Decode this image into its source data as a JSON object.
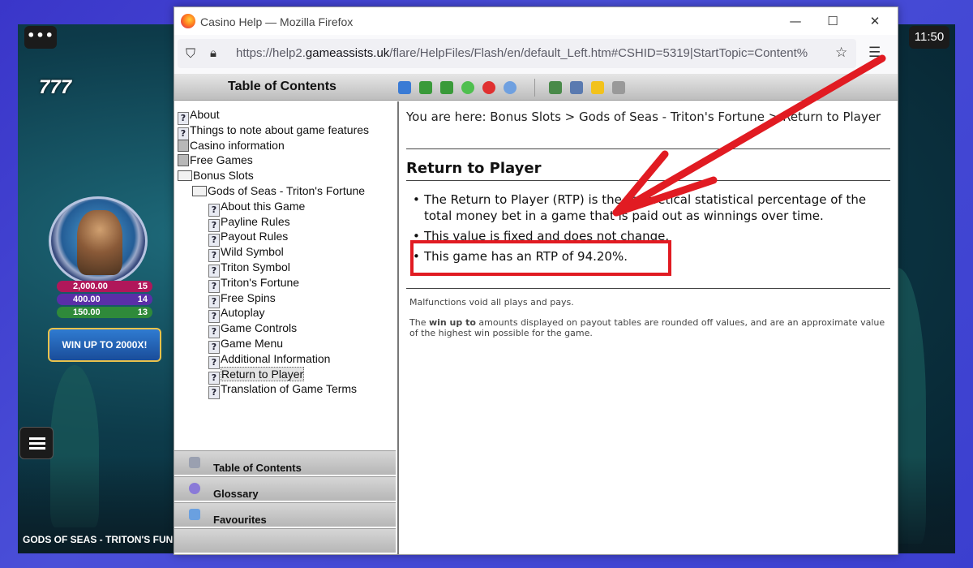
{
  "os": {
    "clock": "11:50"
  },
  "game": {
    "title": "GODS OF SEAS - TRITON'S FUNE",
    "logo": "777",
    "menu_dots": "•••",
    "jackpots": [
      {
        "amount": "2,000.00",
        "count": "15",
        "color": "#b0175a"
      },
      {
        "amount": "400.00",
        "count": "14",
        "color": "#5a2fa8"
      },
      {
        "amount": "150.00",
        "count": "13",
        "color": "#2f8a3a"
      }
    ],
    "win_button": "WIN UP TO 2000X!"
  },
  "browser": {
    "title": "Casino Help — Mozilla Firefox",
    "url_prefix": "https://help2.",
    "url_domain": "gameassists.uk",
    "url_rest": "/flare/HelpFiles/Flash/en/default_Left.htm#CSHID=5319|StartTopic=Content%",
    "controls": {
      "minimize": "—",
      "maximize": "☐",
      "close": "✕"
    }
  },
  "help": {
    "toc_title": "Table of Contents",
    "toc": [
      {
        "label": "About",
        "icon": "help-topic-icon",
        "indent": 0
      },
      {
        "label": "Things to note about game features",
        "icon": "help-topic-icon",
        "indent": 0
      },
      {
        "label": "Casino information",
        "icon": "book-closed-icon",
        "indent": 0
      },
      {
        "label": "Free Games",
        "icon": "book-closed-icon",
        "indent": 0
      },
      {
        "label": "Bonus Slots",
        "icon": "book-open-icon",
        "indent": 0
      },
      {
        "label": "Gods of Seas - Triton's Fortune",
        "icon": "book-open-icon",
        "indent": 1
      },
      {
        "label": "About this Game",
        "icon": "help-topic-icon",
        "indent": 2
      },
      {
        "label": "Payline Rules",
        "icon": "help-topic-icon",
        "indent": 2
      },
      {
        "label": "Payout Rules",
        "icon": "help-topic-icon",
        "indent": 2
      },
      {
        "label": "Wild Symbol",
        "icon": "help-topic-icon",
        "indent": 2
      },
      {
        "label": "Triton Symbol",
        "icon": "help-topic-icon",
        "indent": 2
      },
      {
        "label": "Triton's Fortune",
        "icon": "help-topic-icon",
        "indent": 2
      },
      {
        "label": "Free Spins",
        "icon": "help-topic-icon",
        "indent": 2
      },
      {
        "label": "Autoplay",
        "icon": "help-topic-icon",
        "indent": 2
      },
      {
        "label": "Game Controls",
        "icon": "help-topic-icon",
        "indent": 2
      },
      {
        "label": "Game Menu",
        "icon": "help-topic-icon",
        "indent": 2
      },
      {
        "label": "Additional Information",
        "icon": "help-topic-icon",
        "indent": 2
      },
      {
        "label": "Return to Player",
        "icon": "help-topic-icon",
        "indent": 2,
        "selected": true
      },
      {
        "label": "Translation of Game Terms",
        "icon": "help-topic-icon",
        "indent": 2
      }
    ],
    "nav_tabs": [
      "Table of Contents",
      "Glossary",
      "Favourites"
    ],
    "breadcrumb": "You are here: Bonus Slots > Gods of Seas - Triton's Fortune > Return to Player",
    "heading": "Return to Player",
    "bullets": [
      "The Return to Player (RTP) is the theoretical statistical percentage of the total money bet in a game that is paid out as winnings over time.",
      "This value is fixed and does not change.",
      "This game has an RTP of 94.20%."
    ],
    "notes": {
      "malfunctions": "Malfunctions void all plays and pays.",
      "win_prefix": "The ",
      "win_bold": "win up to",
      "win_rest": " amounts displayed on payout tables are rounded off values, and are an approximate value of the highest win possible for the game."
    }
  },
  "annotation": {
    "highlight_color": "#e11b22"
  }
}
